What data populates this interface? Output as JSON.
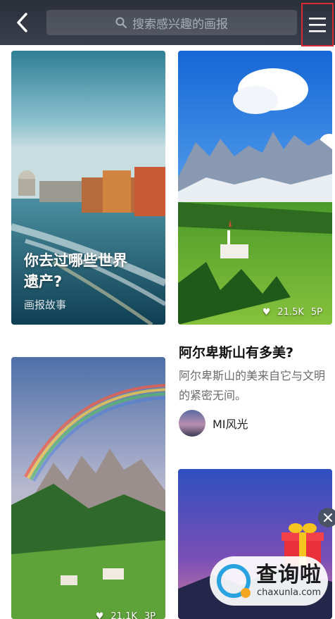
{
  "header": {
    "search_placeholder": "搜索感兴趣的画报",
    "back_icon": "chevron-left-icon",
    "search_icon": "search-icon",
    "menu_icon": "hamburger-menu-icon"
  },
  "cards": [
    {
      "title": "你去过哪些世界遗产?",
      "title_line1": "你去过哪些世界",
      "title_line2": "遗产?",
      "subtitle": "画报故事"
    },
    {
      "likes": "21.5K",
      "pages": "5P"
    },
    {
      "likes": "21.1K",
      "pages": "3P"
    }
  ],
  "article": {
    "title": "阿尔卑斯山有多美?",
    "description": "阿尔卑斯山的美来自它与文明的紧密无间。",
    "author": "MI风光"
  },
  "watermark": {
    "brand_cn": "查询啦",
    "brand_en": "chaxunla.com"
  },
  "colors": {
    "header_bg": "#2b2f3a",
    "highlight_border": "#d62b36",
    "watermark_blue": "#29a3e0"
  }
}
